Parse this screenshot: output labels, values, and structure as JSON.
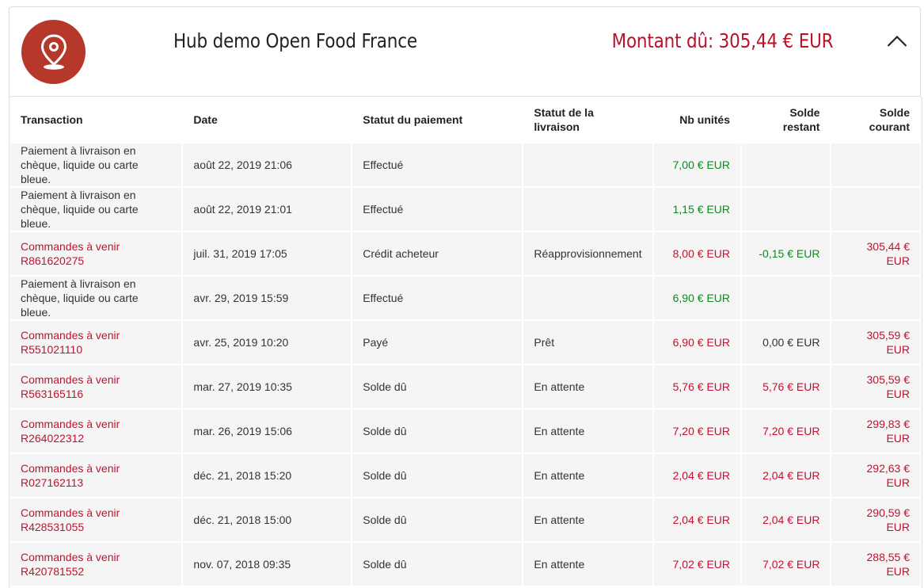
{
  "header": {
    "hub_name": "Hub demo Open Food France",
    "amount_due": "Montant dû: 305,44 € EUR",
    "logo_icon": "map-pin-icon",
    "collapse_icon": "chevron-up-icon",
    "brand_color": "#b5382b",
    "accent_color": "#b7142b"
  },
  "table": {
    "columns": [
      "Transaction",
      "Date",
      "Statut du paiement",
      "Statut de la livraison",
      "Nb unités",
      "Solde restant",
      "Solde courant"
    ],
    "rows": [
      {
        "transaction": "Paiement à livraison en chèque, liquide ou carte bleue.",
        "link": false,
        "date": "août 22, 2019 21:06",
        "payment": "Effectué",
        "delivery": "",
        "units": "7,00 € EUR",
        "units_color": "green",
        "remaining": "",
        "remaining_color": "dark",
        "current": "",
        "current_color": "red"
      },
      {
        "transaction": "Paiement à livraison en chèque, liquide ou carte bleue.",
        "link": false,
        "date": "août 22, 2019 21:01",
        "payment": "Effectué",
        "delivery": "",
        "units": "1,15 € EUR",
        "units_color": "green",
        "remaining": "",
        "remaining_color": "dark",
        "current": "",
        "current_color": "red"
      },
      {
        "transaction": "Commandes à venir R861620275",
        "link": true,
        "date": "juil. 31, 2019 17:05",
        "payment": "Crédit acheteur",
        "delivery": "Réapprovisionnement",
        "units": "8,00 € EUR",
        "units_color": "red",
        "remaining": "-0,15 € EUR",
        "remaining_color": "green",
        "current": "305,44 € EUR",
        "current_color": "red"
      },
      {
        "transaction": "Paiement à livraison en chèque, liquide ou carte bleue.",
        "link": false,
        "date": "avr. 29, 2019 15:59",
        "payment": "Effectué",
        "delivery": "",
        "units": "6,90 € EUR",
        "units_color": "green",
        "remaining": "",
        "remaining_color": "dark",
        "current": "",
        "current_color": "red"
      },
      {
        "transaction": "Commandes à venir R551021110",
        "link": true,
        "date": "avr. 25, 2019 10:20",
        "payment": "Payé",
        "delivery": "Prêt",
        "units": "6,90 € EUR",
        "units_color": "red",
        "remaining": "0,00 € EUR",
        "remaining_color": "dark",
        "current": "305,59 € EUR",
        "current_color": "red"
      },
      {
        "transaction": "Commandes à venir R563165116",
        "link": true,
        "date": "mar. 27, 2019 10:35",
        "payment": "Solde dû",
        "delivery": "En attente",
        "units": "5,76 € EUR",
        "units_color": "red",
        "remaining": "5,76 € EUR",
        "remaining_color": "red",
        "current": "305,59 € EUR",
        "current_color": "red"
      },
      {
        "transaction": "Commandes à venir R264022312",
        "link": true,
        "date": "mar. 26, 2019 15:06",
        "payment": "Solde dû",
        "delivery": "En attente",
        "units": "7,20 € EUR",
        "units_color": "red",
        "remaining": "7,20 € EUR",
        "remaining_color": "red",
        "current": "299,83 € EUR",
        "current_color": "red"
      },
      {
        "transaction": "Commandes à venir R027162113",
        "link": true,
        "date": "déc. 21, 2018 15:20",
        "payment": "Solde dû",
        "delivery": "En attente",
        "units": "2,04 € EUR",
        "units_color": "red",
        "remaining": "2,04 € EUR",
        "remaining_color": "red",
        "current": "292,63 € EUR",
        "current_color": "red"
      },
      {
        "transaction": "Commandes à venir R428531055",
        "link": true,
        "date": "déc. 21, 2018 15:00",
        "payment": "Solde dû",
        "delivery": "En attente",
        "units": "2,04 € EUR",
        "units_color": "red",
        "remaining": "2,04 € EUR",
        "remaining_color": "red",
        "current": "290,59 € EUR",
        "current_color": "red"
      },
      {
        "transaction": "Commandes à venir R420781552",
        "link": true,
        "date": "nov. 07, 2018 09:35",
        "payment": "Solde dû",
        "delivery": "En attente",
        "units": "7,02 € EUR",
        "units_color": "red",
        "remaining": "7,02 € EUR",
        "remaining_color": "red",
        "current": "288,55 € EUR",
        "current_color": "red"
      }
    ]
  }
}
